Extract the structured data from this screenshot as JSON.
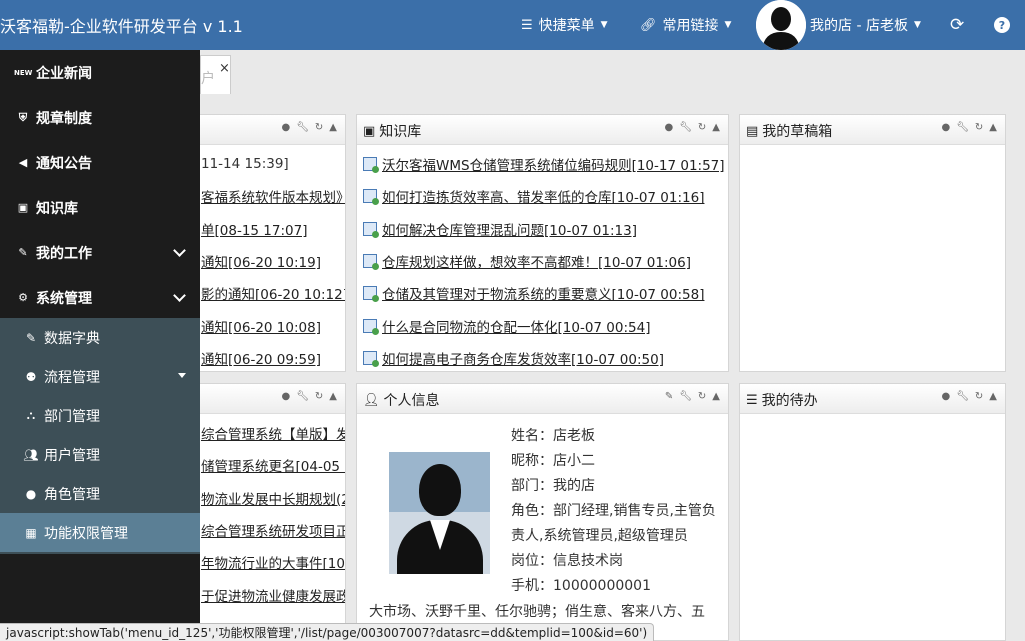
{
  "header": {
    "brand": "沃客福勒-企业软件研发平台 v 1.1",
    "quick_menu": "快捷菜单",
    "common_links": "常用链接",
    "user_label": "我的店 - 店老板",
    "icons": {
      "quick_menu": "list-icon",
      "links": "link-icon",
      "refresh": "refresh-icon",
      "help": "help-icon"
    },
    "color": "#3b6fa9"
  },
  "tabs": [
    {
      "label": "户",
      "close": "×"
    }
  ],
  "sidebar": {
    "items": [
      {
        "label": "企业新闻",
        "icon": "NEW"
      },
      {
        "label": "规章制度",
        "icon": "shield"
      },
      {
        "label": "通知公告",
        "icon": "speaker"
      },
      {
        "label": "知识库",
        "icon": "book"
      },
      {
        "label": "我的工作",
        "icon": "edit"
      },
      {
        "label": "系统管理",
        "icon": "gear"
      }
    ],
    "sub_items": [
      {
        "label": "数据字典"
      },
      {
        "label": "流程管理"
      },
      {
        "label": "部门管理"
      },
      {
        "label": "用户管理"
      },
      {
        "label": "角色管理"
      },
      {
        "label": "功能权限管理"
      }
    ],
    "active": "功能权限管理"
  },
  "left_top_list": [
    "11-14 15:39]",
    "客福系统软件版本规划》",
    "单[08-15 17:07]",
    "通知[06-20 10:19]",
    "影的通知[06-20 10:12]",
    "通知[06-20 10:08]",
    "通知[06-20 09:59]"
  ],
  "left_bottom_list": [
    "综合管理系统【单版】发",
    "储管理系统更名[04-05 1",
    "物流业发展中长期规划(2",
    "综合管理系统研发项目正",
    "年物流行业的大事件[10-",
    "于促进物流业健康发展政"
  ],
  "knowledge": {
    "title": "知识库",
    "items": [
      "沃尔客福WMS仓储管理系统储位编码规则[10-17 01:57]",
      "如何打造拣货效率高、错发率低的仓库[10-07 01:16]",
      "如何解决仓库管理混乱问题[10-07 01:13]",
      "仓库规划这样做，想效率不高都难！[10-07 01:06]",
      "仓储及其管理对于物流系统的重要意义[10-07 00:58]",
      "什么是合同物流的仓配一体化[10-07 00:54]",
      "如何提高电子商务仓库发货效率[10-07 00:50]"
    ]
  },
  "drafts": {
    "title": "我的草稿箱"
  },
  "todo": {
    "title": "我的待办"
  },
  "profile": {
    "title": "个人信息",
    "name_label": "姓名：",
    "name": "店老板",
    "nickname_label": "昵称：",
    "nickname": "店小二",
    "dept_label": "部门：",
    "dept": "我的店",
    "role_label": "角色：",
    "role": "部门经理,销售专员,主管负责人,系统管理员,超级管理员",
    "post_label": "岗位：",
    "post": "信息技术岗",
    "phone_label": "手机：",
    "phone": "10000000001",
    "motto": "大市场、沃野千里、任尔驰骋；俏生意、客来八方、五"
  },
  "status_bar": "javascript:showTab('menu_id_125','功能权限管理','/list/page/003007007?datasrc=dd&templid=100&id=60')"
}
